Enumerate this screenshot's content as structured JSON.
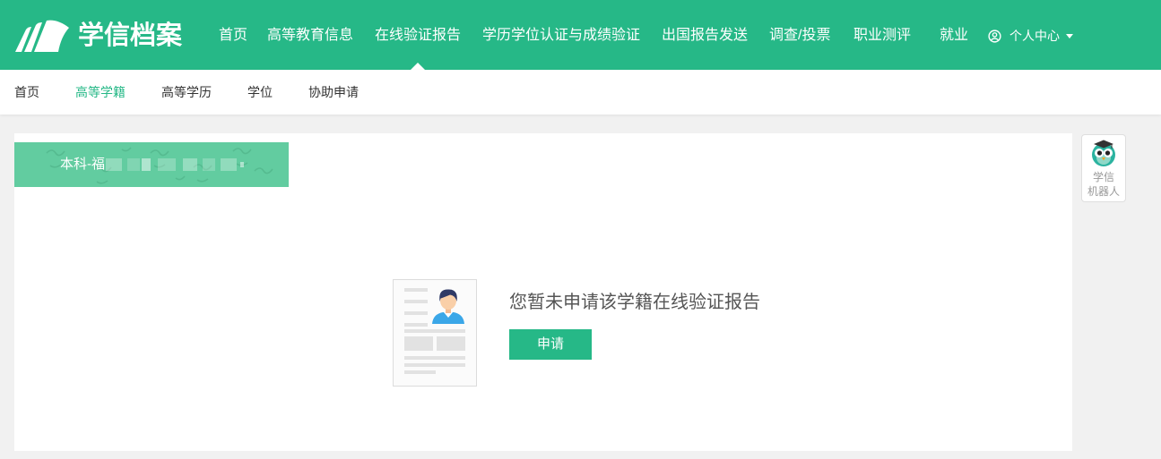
{
  "header": {
    "logo_text": "学信档案",
    "nav": [
      {
        "label": "首页"
      },
      {
        "label": "高等教育信息"
      },
      {
        "label": "在线验证报告",
        "active": true
      },
      {
        "label": "学历学位认证与成绩验证"
      },
      {
        "label": "出国报告发送"
      },
      {
        "label": "调查/投票"
      },
      {
        "label": "职业测评"
      },
      {
        "label": "就业"
      }
    ],
    "user_center": "个人中心"
  },
  "subnav": {
    "items": [
      {
        "label": "首页"
      },
      {
        "label": "高等学籍",
        "active": true
      },
      {
        "label": "高等学历"
      },
      {
        "label": "学位"
      },
      {
        "label": "协助申请"
      }
    ]
  },
  "record": {
    "tab_label": "本科-福"
  },
  "empty_state": {
    "message": "您暂未申请该学籍在线验证报告",
    "apply_button": "申请"
  },
  "robot": {
    "line1": "学信",
    "line2": "机器人"
  },
  "icons": {
    "logo": "logo-icon",
    "user": "user-icon",
    "caret": "caret-down-icon",
    "robot": "owl-robot-icon",
    "avatar": "avatar-icon"
  },
  "colors": {
    "brand": "#26b887",
    "record_tab": "#62cca0",
    "muted": "#999999"
  }
}
